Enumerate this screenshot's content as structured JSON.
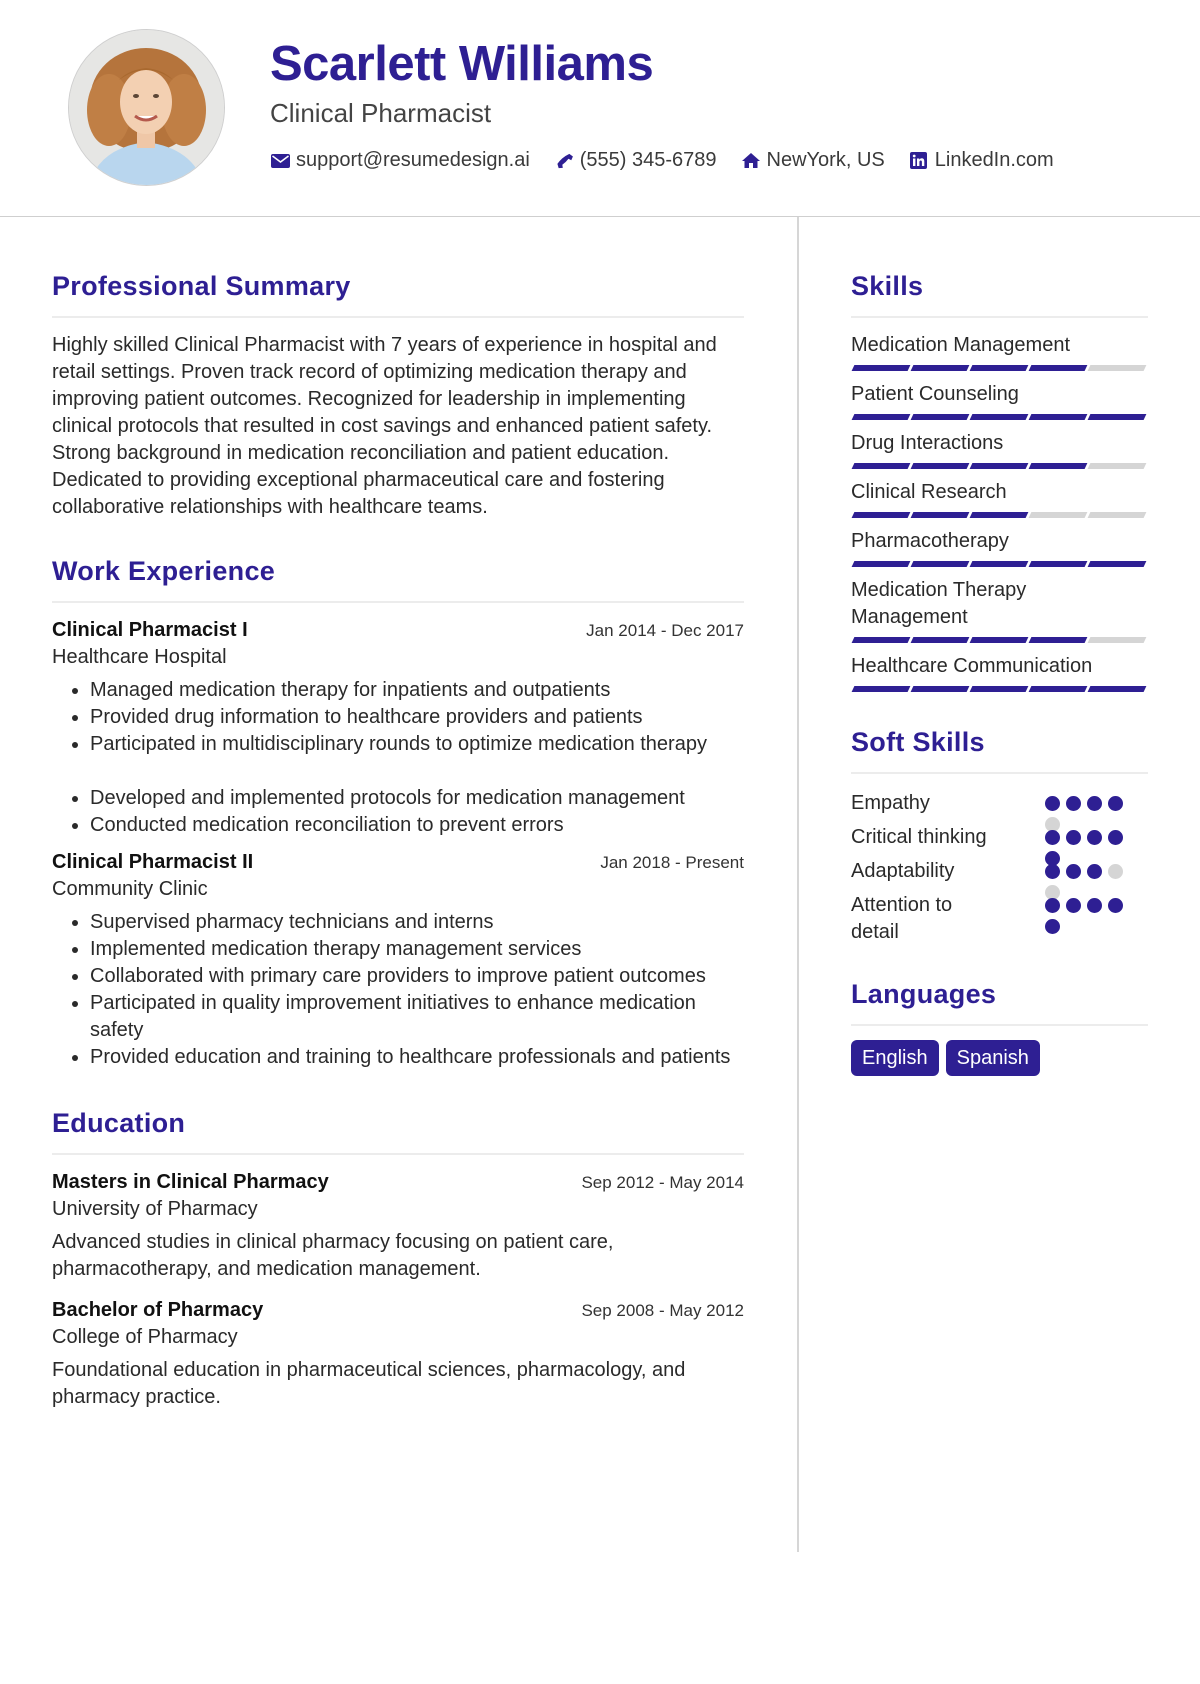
{
  "header": {
    "name": "Scarlett Williams",
    "title": "Clinical Pharmacist",
    "contacts": [
      {
        "icon": "envelope-icon",
        "text": "support@resumedesign.ai"
      },
      {
        "icon": "phone-icon",
        "text": "(555) 345-6789"
      },
      {
        "icon": "home-icon",
        "text": "NewYork, US"
      },
      {
        "icon": "linkedin-icon",
        "text": "LinkedIn.com"
      }
    ]
  },
  "colors": {
    "primary": "#2e1f93",
    "inactive": "#d5d5d5"
  },
  "summary": {
    "heading": "Professional Summary",
    "text": "Highly skilled Clinical Pharmacist with 7 years of experience in hospital and retail settings. Proven track record of optimizing medication therapy and improving patient outcomes. Recognized for leadership in implementing clinical protocols that resulted in cost savings and enhanced patient safety. Strong background in medication reconciliation and patient education. Dedicated to providing exceptional pharmaceutical care and fostering collaborative relationships with healthcare teams."
  },
  "experience": {
    "heading": "Work Experience",
    "jobs": [
      {
        "title": "Clinical Pharmacist I",
        "org": "Healthcare Hospital",
        "dates": "Jan 2014 - Dec 2017",
        "bullets": [
          "Managed medication therapy for inpatients and outpatients",
          "Provided drug information to healthcare providers and patients",
          "Participated in multidisciplinary rounds to optimize medication therapy",
          "Developed and implemented protocols for medication management",
          "Conducted medication reconciliation to prevent errors"
        ]
      },
      {
        "title": "Clinical Pharmacist II",
        "org": "Community Clinic",
        "dates": "Jan 2018 - Present",
        "bullets": [
          "Supervised pharmacy technicians and interns",
          "Implemented medication therapy management services",
          "Collaborated with primary care providers to improve patient outcomes",
          "Participated in quality improvement initiatives to enhance medication safety",
          "Provided education and training to healthcare professionals and patients"
        ]
      }
    ]
  },
  "education": {
    "heading": "Education",
    "items": [
      {
        "degree": "Masters in Clinical Pharmacy",
        "school": "University of Pharmacy",
        "dates": "Sep 2012 - May 2014",
        "description": "Advanced studies in clinical pharmacy focusing on patient care, pharmacotherapy, and medication management."
      },
      {
        "degree": "Bachelor of Pharmacy",
        "school": "College of Pharmacy",
        "dates": "Sep 2008 - May 2012",
        "description": "Foundational education in pharmaceutical sciences, pharmacology, and pharmacy practice."
      }
    ]
  },
  "skills": {
    "heading": "Skills",
    "max": 5,
    "items": [
      {
        "name": "Medication Management",
        "level": 4
      },
      {
        "name": "Patient Counseling",
        "level": 5
      },
      {
        "name": "Drug Interactions",
        "level": 4
      },
      {
        "name": "Clinical Research",
        "level": 3
      },
      {
        "name": "Pharmacotherapy",
        "level": 5
      },
      {
        "name": "Medication Therapy Management",
        "level": 4
      },
      {
        "name": "Healthcare Communication",
        "level": 5
      }
    ]
  },
  "soft_skills": {
    "heading": "Soft Skills",
    "max": 5,
    "items": [
      {
        "name": "Empathy",
        "level": 4
      },
      {
        "name": "Critical thinking",
        "level": 5
      },
      {
        "name": "Adaptability",
        "level": 3
      },
      {
        "name": "Attention to detail",
        "level": 5
      }
    ]
  },
  "languages": {
    "heading": "Languages",
    "items": [
      "English",
      "Spanish"
    ]
  }
}
